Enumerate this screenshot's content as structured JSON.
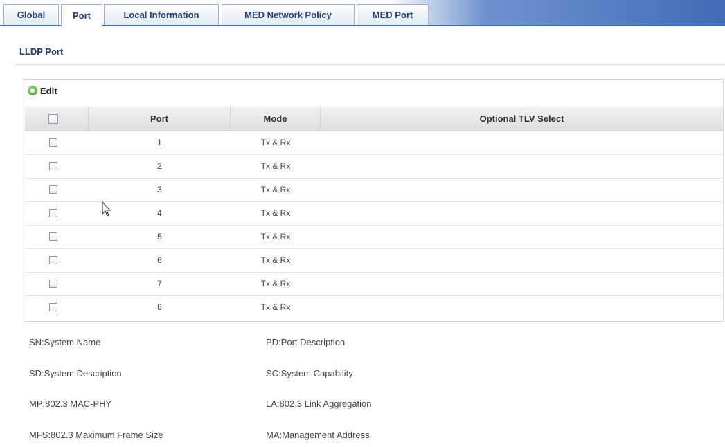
{
  "tabs": [
    {
      "label": "Global",
      "active": false
    },
    {
      "label": "Port",
      "active": true
    },
    {
      "label": "Local Information",
      "active": false
    },
    {
      "label": "MED Network Policy",
      "active": false
    },
    {
      "label": "MED Port",
      "active": false
    }
  ],
  "section": {
    "title": "LLDP Port"
  },
  "toolbar": {
    "edit_label": "Edit",
    "edit_icon": "add-circle-icon"
  },
  "table": {
    "columns": [
      "",
      "Port",
      "Mode",
      "Optional TLV Select"
    ],
    "rows": [
      {
        "port": "1",
        "mode": "Tx & Rx",
        "tlv": ""
      },
      {
        "port": "2",
        "mode": "Tx & Rx",
        "tlv": ""
      },
      {
        "port": "3",
        "mode": "Tx & Rx",
        "tlv": ""
      },
      {
        "port": "4",
        "mode": "Tx & Rx",
        "tlv": ""
      },
      {
        "port": "5",
        "mode": "Tx & Rx",
        "tlv": ""
      },
      {
        "port": "6",
        "mode": "Tx & Rx",
        "tlv": ""
      },
      {
        "port": "7",
        "mode": "Tx & Rx",
        "tlv": ""
      },
      {
        "port": "8",
        "mode": "Tx & Rx",
        "tlv": ""
      }
    ]
  },
  "legend": [
    {
      "left": "SN:System Name",
      "right": "PD:Port Description"
    },
    {
      "left": "SD:System Description",
      "right": "SC:System Capability"
    },
    {
      "left": "MP:802.3 MAC-PHY",
      "right": "LA:802.3 Link Aggregation"
    },
    {
      "left": "MFS:802.3 Maximum Frame Size",
      "right": "MA:Management Address"
    }
  ],
  "colors": {
    "accent": "#3f6cb8",
    "tab_text": "#1f3f7a",
    "edit_icon": "#3a9a2a"
  }
}
